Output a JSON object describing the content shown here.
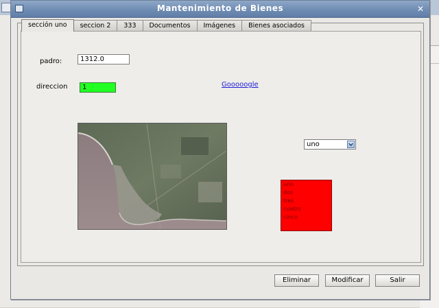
{
  "window": {
    "title": "Mantenimiento de Bienes",
    "close_glyph": "✕"
  },
  "tabs": [
    {
      "label": "sección uno"
    },
    {
      "label": "seccion 2"
    },
    {
      "label": "333"
    },
    {
      "label": "Documentos"
    },
    {
      "label": "Imágenes"
    },
    {
      "label": "Bienes asociados"
    }
  ],
  "form": {
    "padron_label": "padro:",
    "padron_value": "1312.0",
    "direccion_label": "direccion",
    "direccion_value": "1",
    "link_text": "Gooooogle",
    "select_value": "uno",
    "list_items": [
      "uno",
      "dos",
      "tres",
      "cuatro",
      "cinco"
    ]
  },
  "buttons": {
    "eliminar": "Eliminar",
    "modificar": "Modificar",
    "salir": "Salir"
  },
  "colors": {
    "green_field": "#22ff22",
    "red_list": "#ff0000",
    "title_bar": "#6f8cb3"
  },
  "icons": {
    "close": "close-icon",
    "window": "window-icon",
    "select_arrow": "chevron-down-icon"
  }
}
